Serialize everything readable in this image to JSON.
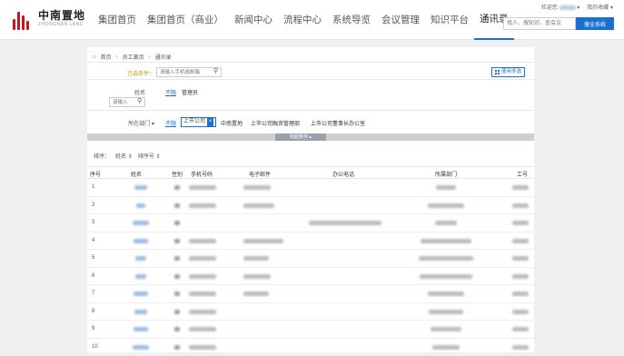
{
  "brand": {
    "name_cn": "中南置地",
    "name_en": "ZHONGNAN LAND"
  },
  "nav": {
    "items": [
      "集团首页",
      "集团首页（商业）",
      "新闻中心",
      "流程中心",
      "系统导览",
      "会议管理",
      "知识平台",
      "通讯录"
    ],
    "active_index": 7
  },
  "user": {
    "welcome": "欢迎您",
    "favorites": "我的收藏"
  },
  "search": {
    "placeholder": "找人、搜知识、查会议",
    "button": "搜全系统"
  },
  "breadcrumb": [
    "首页",
    "员工黄页",
    "通讯录"
  ],
  "filter": {
    "selected_label": "已选条件：",
    "selected_placeholder": "请输入手机或邮箱",
    "multi_button": "使用多选",
    "name_label": "姓名",
    "name_unlimited": "不限",
    "name_option": "管理员",
    "name_placeholder": "请输入",
    "dept_label": "所在部门",
    "dept_unlimited": "不限",
    "dept_selected": "上市公司",
    "dept_options": [
      "中南置地",
      "上市公司融资管理部",
      "上市公司董事长办公室"
    ],
    "collapse": "收起条件"
  },
  "sort": {
    "label": "排序：",
    "by_name": "姓名",
    "by_no": "排序号"
  },
  "table": {
    "headers": [
      "序号",
      "姓名",
      "性别",
      "手机号码",
      "电子邮件",
      "办公电话",
      "所属部门",
      "工号"
    ],
    "rows": [
      {
        "index": "1"
      },
      {
        "index": "2"
      },
      {
        "index": "3"
      },
      {
        "index": "4"
      },
      {
        "index": "5"
      },
      {
        "index": "6"
      },
      {
        "index": "7"
      },
      {
        "index": "8"
      },
      {
        "index": "9"
      },
      {
        "index": "10"
      }
    ]
  },
  "colors": {
    "accent": "#1a6fd3",
    "brand": "#c8161d"
  }
}
